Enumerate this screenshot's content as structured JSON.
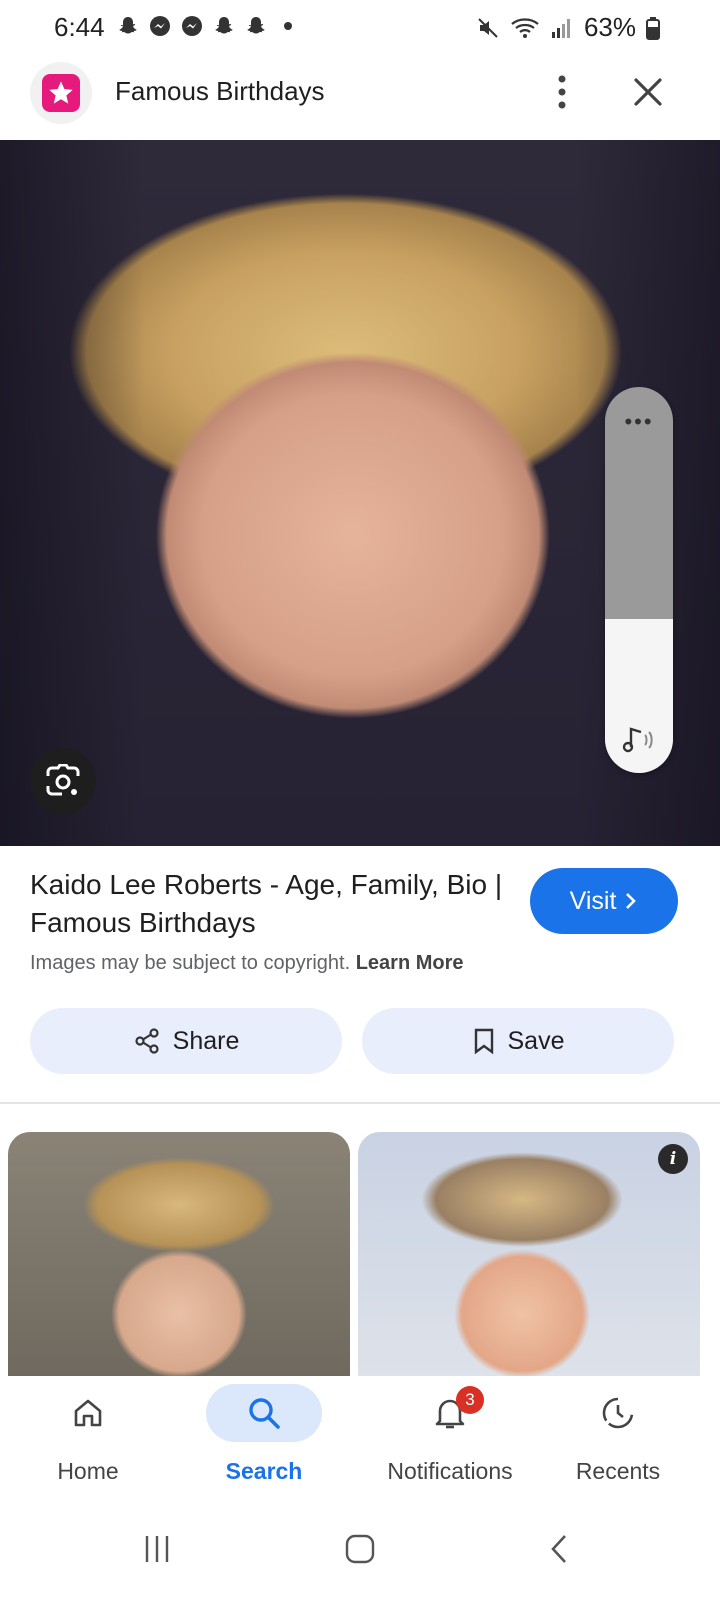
{
  "status_bar": {
    "time": "6:44",
    "battery_text": "63%",
    "notification_icons": [
      "snapchat-icon",
      "messenger-icon",
      "messenger-icon",
      "snapchat-icon",
      "snapchat-icon",
      "dot-icon"
    ],
    "system_icons": [
      "mute-icon",
      "wifi-icon",
      "signal-icon",
      "battery-icon"
    ]
  },
  "header": {
    "title": "Famous Birthdays",
    "logo_icon": "famous-birthdays-logo",
    "brand_color": "#e6197d"
  },
  "hero": {
    "volume_level_percent": 40,
    "volume_more": "•••"
  },
  "result": {
    "title": "Kaido Lee Roberts - Age, Family, Bio | Famous Birthdays",
    "visit_label": "Visit",
    "copyright_text": "Images may be subject to copyright.",
    "learn_more": "Learn More",
    "share_label": "Share",
    "save_label": "Save",
    "accent_color": "#1a73e8"
  },
  "related": {
    "info_badge": "i"
  },
  "bottom_nav": {
    "items": [
      {
        "label": "Home",
        "icon": "home-icon"
      },
      {
        "label": "Search",
        "icon": "search-icon",
        "active": true
      },
      {
        "label": "Notifications",
        "icon": "bell-icon",
        "badge": "3"
      },
      {
        "label": "Recents",
        "icon": "recents-icon"
      }
    ]
  }
}
